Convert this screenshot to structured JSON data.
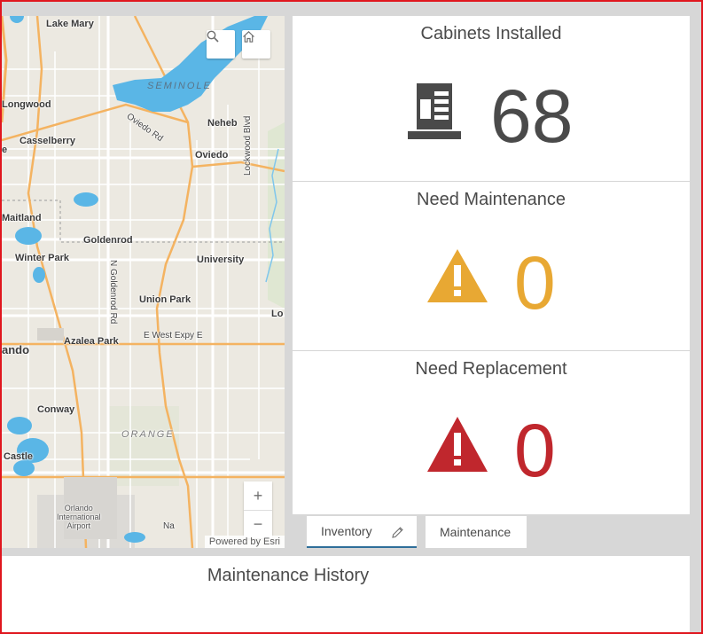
{
  "map": {
    "labels": {
      "lake_mary": "Lake Mary",
      "seminole": "SEMINOLE",
      "longwood": "Longwood",
      "oviedo_rd": "Oviedo Rd",
      "neheb": "Neheb",
      "casselberry": "Casselberry",
      "oviedo": "Oviedo",
      "e": "e",
      "lockwood_blvd": "Lockwood Blvd",
      "maitland": "Maitland",
      "goldenrod": "Goldenrod",
      "winter_park": "Winter Park",
      "university": "University",
      "n_goldenrod_rd": "N Goldenrod Rd",
      "union_park": "Union Park",
      "lo": "Lo",
      "ando": "ando",
      "azalea_park": "Azalea Park",
      "e_west_expy": "E West Expy E",
      "conway": "Conway",
      "orange": "ORANGE",
      "castle": "Castle",
      "airport": "Orlando\nInternational\nAirport",
      "na": "Na"
    },
    "search_icon": "search-icon",
    "home_icon": "home-icon",
    "zoom_in": "+",
    "zoom_out": "−",
    "attribution": "Powered by Esri"
  },
  "indicators": [
    {
      "title": "Cabinets Installed",
      "value": "68",
      "icon": "cabinet-icon",
      "color": "#4a4a4a"
    },
    {
      "title": "Need Maintenance",
      "value": "0",
      "icon": "warning-icon",
      "color": "#e8a833"
    },
    {
      "title": "Need Replacement",
      "value": "0",
      "icon": "warning-icon",
      "color": "#c0272d"
    }
  ],
  "tabs": [
    {
      "label": "Inventory",
      "active": true,
      "icon": "pencil-icon"
    },
    {
      "label": "Maintenance",
      "active": false
    }
  ],
  "history": {
    "title": "Maintenance History"
  },
  "colors": {
    "accent": "#2f6f9a",
    "frame": "#e0161e",
    "water": "#5ab6e6",
    "major_road": "#f4b361"
  }
}
